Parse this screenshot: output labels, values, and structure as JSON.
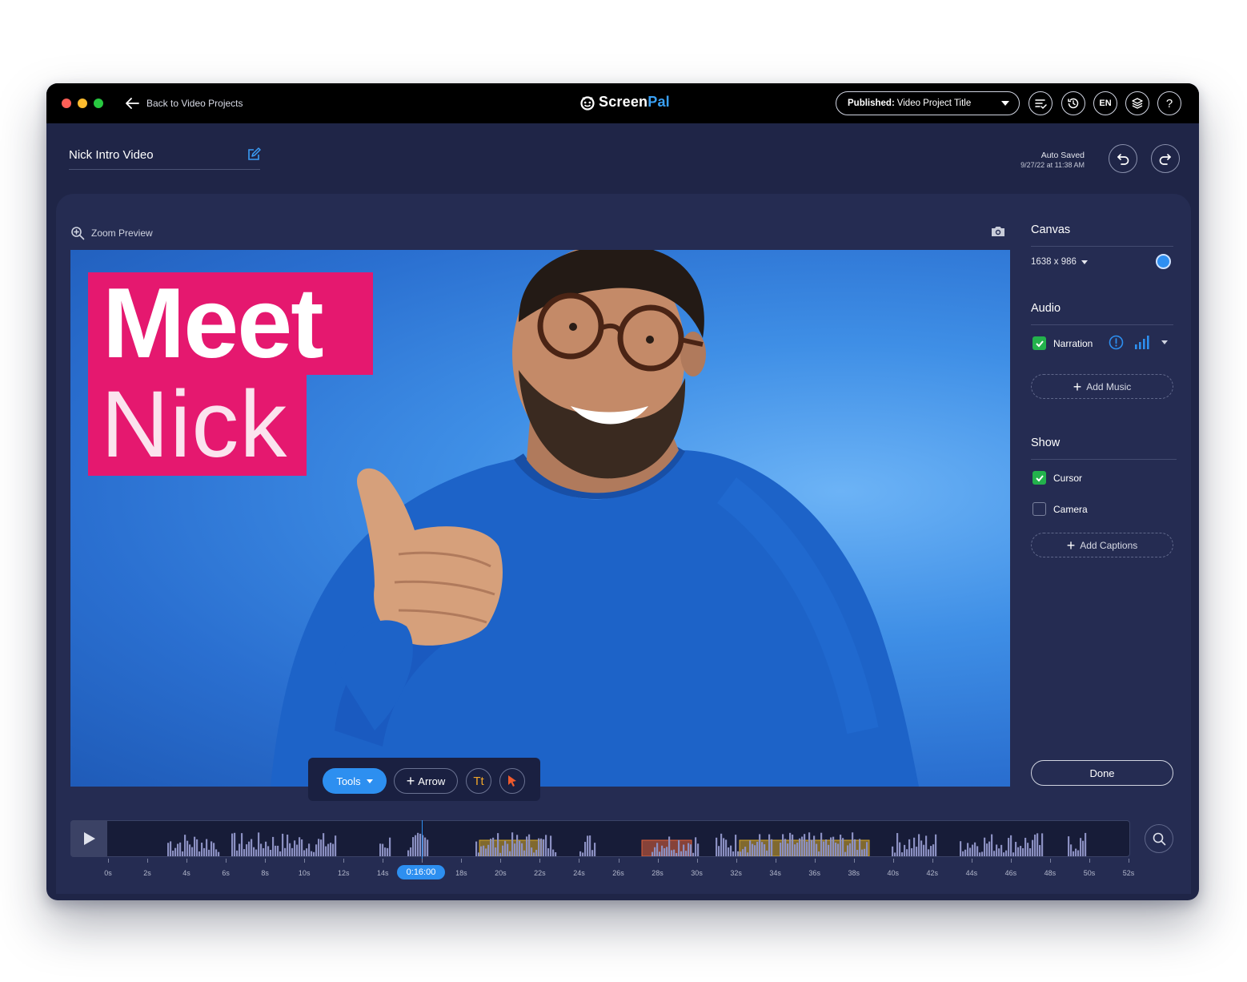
{
  "titlebar": {
    "back_label": "Back to Video Projects",
    "logo_screen": "Screen",
    "logo_pal": "Pal",
    "publish_prefix": "Published:",
    "publish_title": "Video Project Title",
    "lang": "EN",
    "help": "?",
    "icons": [
      "playlist-check-icon",
      "history-icon",
      "layers-icon"
    ]
  },
  "project": {
    "title": "Nick Intro Video",
    "auto_saved_label": "Auto Saved",
    "auto_saved_time": "9/27/22 at 11:38 AM"
  },
  "preview": {
    "zoom_label": "Zoom Preview",
    "overlay_line1": "Meet",
    "overlay_line2": "Nick",
    "overlay_color": "#e5186f"
  },
  "toolbar": {
    "tools_label": "Tools",
    "arrow_label": "Arrow",
    "text_tool_glyph": "Tt"
  },
  "side_panel": {
    "canvas_heading": "Canvas",
    "canvas_size": "1638 x 986",
    "canvas_color": "#2f8ff1",
    "audio_heading": "Audio",
    "narration_label": "Narration",
    "narration_checked": true,
    "add_music_label": "Add Music",
    "show_heading": "Show",
    "cursor_label": "Cursor",
    "cursor_checked": true,
    "camera_label": "Camera",
    "camera_checked": false,
    "add_captions_label": "Add Captions",
    "done_label": "Done"
  },
  "timeline": {
    "current_time": "0:16:00",
    "tick_labels": [
      "0s",
      "2s",
      "4s",
      "6s",
      "8s",
      "10s",
      "12s",
      "14s",
      "16s",
      "18s",
      "20s",
      "22s",
      "24s",
      "26s",
      "28s",
      "30s",
      "32s",
      "34s",
      "36s",
      "38s",
      "40s",
      "42s",
      "44s",
      "46s",
      "48s",
      "50s",
      "52s"
    ],
    "colors": {
      "accent": "#2d8ff0",
      "segment_yellow": "#d7a928",
      "segment_orange": "#e2623a"
    }
  }
}
